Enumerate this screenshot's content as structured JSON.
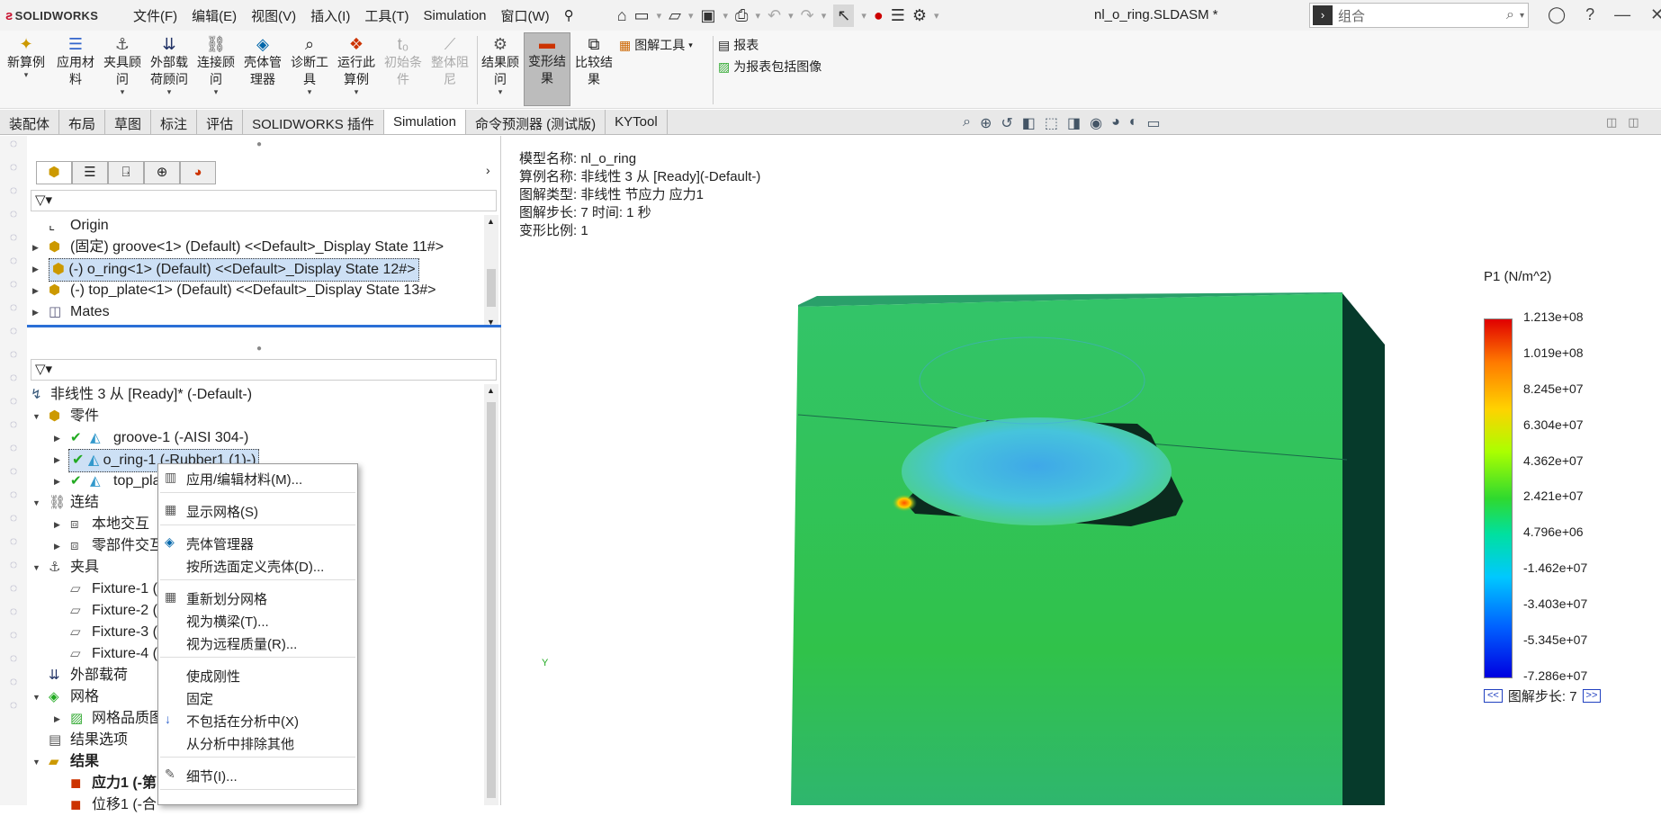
{
  "app": {
    "logo": "SOLIDWORKS",
    "doc_title": "nl_o_ring.SLDASM *"
  },
  "menu": [
    "文件(F)",
    "编辑(E)",
    "视图(V)",
    "插入(I)",
    "工具(T)",
    "Simulation",
    "窗口(W)"
  ],
  "search": {
    "placeholder": "组合"
  },
  "ribbon": {
    "buttons": [
      {
        "l1": "新算例",
        "l2": "",
        "icon": "study-icon"
      },
      {
        "l1": "应用材",
        "l2": "料",
        "icon": "material-icon"
      },
      {
        "l1": "夹具顾",
        "l2": "问",
        "icon": "fixture-icon"
      },
      {
        "l1": "外部载",
        "l2": "荷顾问",
        "icon": "load-icon"
      },
      {
        "l1": "连接顾",
        "l2": "问",
        "icon": "connection-icon"
      },
      {
        "l1": "壳体管",
        "l2": "理器",
        "icon": "shell-icon"
      },
      {
        "l1": "诊断工",
        "l2": "具",
        "icon": "diagnose-icon"
      },
      {
        "l1": "运行此",
        "l2": "算例",
        "icon": "run-icon"
      },
      {
        "l1": "初始条",
        "l2": "件",
        "icon": "initial-icon"
      },
      {
        "l1": "整体阻",
        "l2": "尼",
        "icon": "damping-icon"
      },
      {
        "l1": "结果顾",
        "l2": "问",
        "icon": "result-advisor-icon"
      },
      {
        "l1": "变形结",
        "l2": "果",
        "icon": "deformed-icon"
      },
      {
        "l1": "比较结",
        "l2": "果",
        "icon": "compare-icon"
      }
    ],
    "plot_tools": "图解工具",
    "report": "报表",
    "include_image": "为报表包括图像"
  },
  "tabs": [
    "装配体",
    "布局",
    "草图",
    "标注",
    "评估",
    "SOLIDWORKS 插件",
    "Simulation",
    "命令预测器 (测试版)",
    "KYTool"
  ],
  "feature_tree": [
    {
      "text": "Origin",
      "icon": "origin-icon"
    },
    {
      "text": "(固定) groove<1> (Default) <<Default>_Display State 11#>",
      "icon": "part-icon"
    },
    {
      "text": "(-) o_ring<1> (Default) <<Default>_Display State 12#>",
      "icon": "part-icon"
    },
    {
      "text": "(-) top_plate<1> (Default) <<Default>_Display State 13#>",
      "icon": "part-icon"
    },
    {
      "text": "Mates",
      "icon": "mates-icon"
    }
  ],
  "study_tree": {
    "root": "非线性 3 从 [Ready]* (-Default-)",
    "parts_label": "零件",
    "parts": [
      "groove-1 (-AISI 304-)",
      "o_ring-1 (-Rubber1 (1)-)",
      "top_pla"
    ],
    "connections": "连结",
    "conn_items": [
      "本地交互",
      "零部件交互"
    ],
    "fixtures": "夹具",
    "fixture_items": [
      "Fixture-1 (:",
      "Fixture-2 (:",
      "Fixture-3 (:",
      "Fixture-4 (:"
    ],
    "loads": "外部载荷",
    "mesh": "网格",
    "mesh_quality": "网格品质图",
    "result_options": "结果选项",
    "results": "结果",
    "stress": "应力1 (-第",
    "disp": "位移1 (-合"
  },
  "context_menu": [
    "应用/编辑材料(M)...",
    "显示网格(S)",
    "壳体管理器",
    "按所选面定义壳体(D)...",
    "重新划分网格",
    "视为横梁(T)...",
    "视为远程质量(R)...",
    "使成刚性",
    "固定",
    "不包括在分析中(X)",
    "从分析中排除其他",
    "细节(I)..."
  ],
  "plot_info": {
    "model": "模型名称: nl_o_ring",
    "study": "算例名称: 非线性 3 从 [Ready](-Default-)",
    "type": "图解类型: 非线性 节应力 应力1",
    "step": "图解步长: 7   时间: 1 秒",
    "scale": "变形比例: 1"
  },
  "legend": {
    "title": "P1 (N/m^2)",
    "ticks": [
      "1.213e+08",
      "1.019e+08",
      "8.245e+07",
      "6.304e+07",
      "4.362e+07",
      "2.421e+07",
      "4.796e+06",
      "-1.462e+07",
      "-3.403e+07",
      "-5.345e+07",
      "-7.286e+07"
    ],
    "prev": "<<",
    "next": ">>",
    "step_label": "图解步长: 7"
  },
  "axis": {
    "y": "Y"
  }
}
